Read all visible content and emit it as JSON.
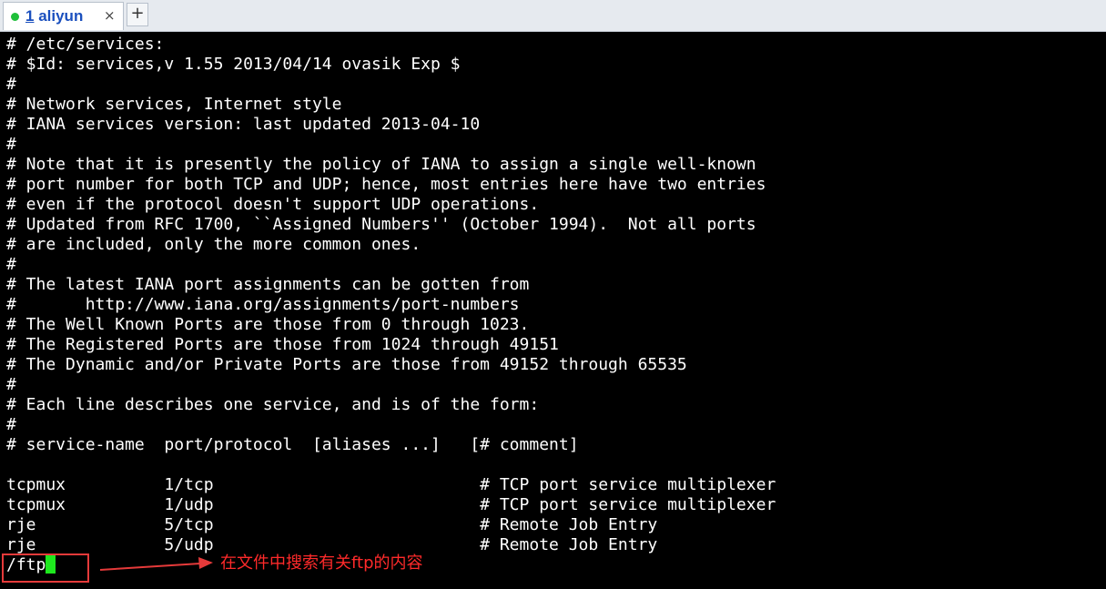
{
  "tabs": [
    {
      "number": "1",
      "label": "aliyun",
      "close": "×"
    }
  ],
  "tab_add": "+",
  "terminal": {
    "lines": [
      "# /etc/services:",
      "# $Id: services,v 1.55 2013/04/14 ovasik Exp $",
      "#",
      "# Network services, Internet style",
      "# IANA services version: last updated 2013-04-10",
      "#",
      "# Note that it is presently the policy of IANA to assign a single well-known",
      "# port number for both TCP and UDP; hence, most entries here have two entries",
      "# even if the protocol doesn't support UDP operations.",
      "# Updated from RFC 1700, ``Assigned Numbers'' (October 1994).  Not all ports",
      "# are included, only the more common ones.",
      "#",
      "# The latest IANA port assignments can be gotten from",
      "#       http://www.iana.org/assignments/port-numbers",
      "# The Well Known Ports are those from 0 through 1023.",
      "# The Registered Ports are those from 1024 through 49151",
      "# The Dynamic and/or Private Ports are those from 49152 through 65535",
      "#",
      "# Each line describes one service, and is of the form:",
      "#",
      "# service-name  port/protocol  [aliases ...]   [# comment]",
      "",
      "tcpmux          1/tcp                           # TCP port service multiplexer",
      "tcpmux          1/udp                           # TCP port service multiplexer",
      "rje             5/tcp                           # Remote Job Entry",
      "rje             5/udp                           # Remote Job Entry"
    ],
    "search_command": "/ftp"
  },
  "annotation": {
    "text": "在文件中搜索有关ftp的内容",
    "color": "#ff2a2a"
  },
  "colors": {
    "terminal_bg": "#000000",
    "terminal_fg": "#ffffff",
    "cursor": "#1ee81e",
    "tab_status_dot": "#1fbf3a",
    "tab_label": "#1a4fbe"
  }
}
